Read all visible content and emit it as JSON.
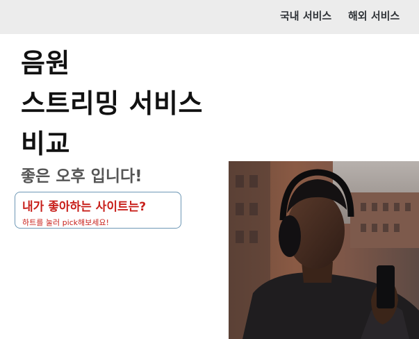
{
  "nav": {
    "domestic_label": "국내 서비스",
    "overseas_label": "해외 서비스"
  },
  "header": {
    "title_line1": "음원",
    "title_line2": "스트리밍 서비스",
    "title_line3": "비교",
    "greeting": "좋은 오후 입니다!"
  },
  "favorite": {
    "question": "내가 좋아하는 사이트는?",
    "hint": "하트를 눌러 pick해보세요!"
  },
  "hero": {
    "image_name": "person-with-headphones-using-phone"
  },
  "colors": {
    "nav_bg": "#ececec",
    "accent_red": "#c8201b",
    "box_border": "#6d97b5"
  }
}
